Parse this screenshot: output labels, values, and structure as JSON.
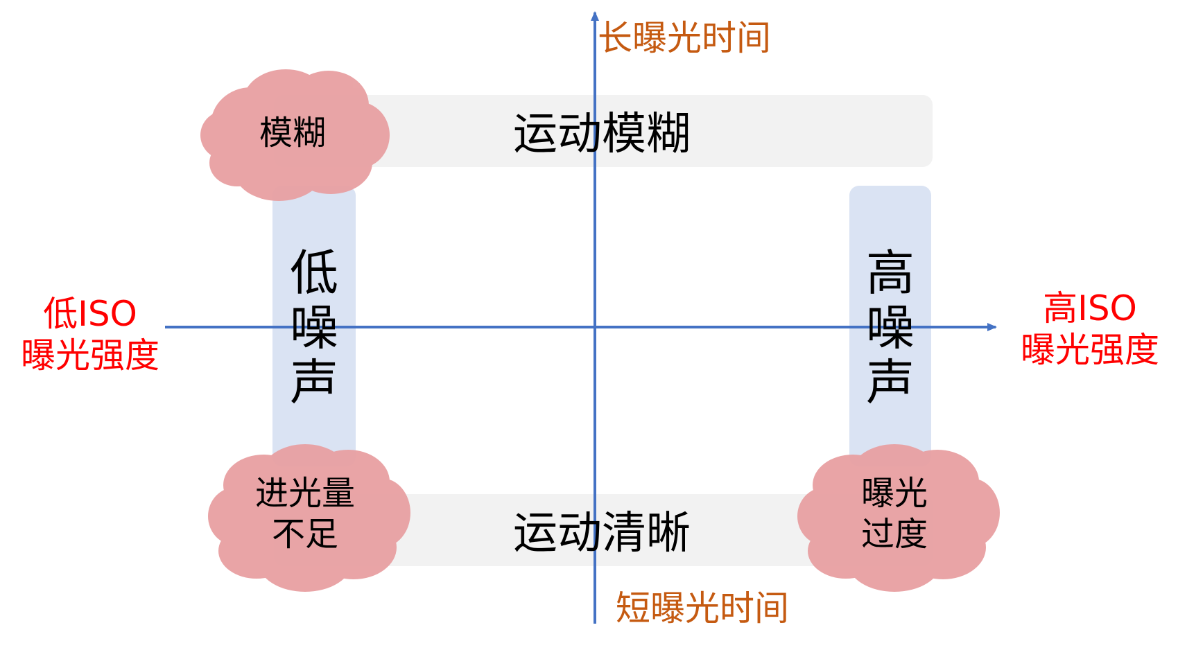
{
  "colors": {
    "axis": "#4472C4",
    "band_gray": "#F2F2F2",
    "band_blue": "#DAE3F3",
    "cloud_fill": "#E8A0A2",
    "cloud_stroke": "#E8A0A2",
    "axis_label_time": "#C55A11",
    "axis_label_iso": "#FF0000",
    "text_dark": "#000000"
  },
  "axes": {
    "top_label": "长曝光时间",
    "bottom_label": "短曝光时间",
    "left_label_line1": "低ISO",
    "left_label_line2": "曝光强度",
    "right_label_line1": "高ISO",
    "right_label_line2": "曝光强度"
  },
  "bands": {
    "top": "运动模糊",
    "bottom": "运动清晰",
    "left": [
      "低",
      "噪",
      "声"
    ],
    "right": [
      "高",
      "噪",
      "声"
    ]
  },
  "clouds": {
    "top_left": [
      "模糊"
    ],
    "bottom_left": [
      "进光量",
      "不足"
    ],
    "bottom_right": [
      "曝光",
      "过度"
    ]
  }
}
